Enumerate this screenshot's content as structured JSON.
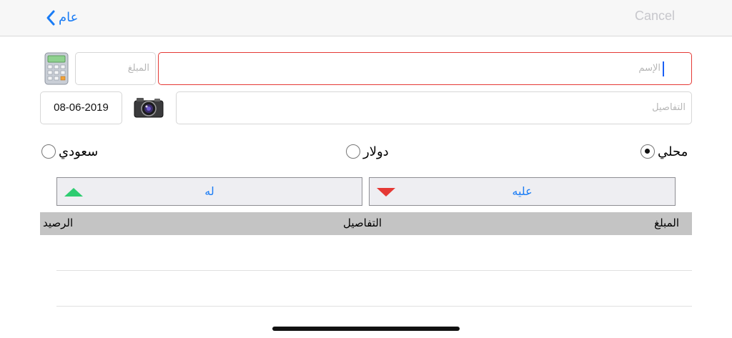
{
  "navbar": {
    "back_label": "عام",
    "cancel_label": "Cancel"
  },
  "form": {
    "name_placeholder": "الإسم",
    "amount_placeholder": "المبلغ",
    "date_value": "08-06-2019",
    "details_placeholder": "التفاصيل"
  },
  "currency": {
    "options": [
      {
        "label": "محلي",
        "selected": true
      },
      {
        "label": "دولار",
        "selected": false
      },
      {
        "label": "سعودي",
        "selected": false
      }
    ]
  },
  "buttons": {
    "debit_label": "عليه",
    "credit_label": "له"
  },
  "table": {
    "headers": [
      "المبلغ",
      "التفاصيل",
      "الرصيد"
    ],
    "rows": []
  },
  "colors": {
    "accent": "#1a7cf5",
    "error_border": "#e53935",
    "up_arrow": "#2ecc71",
    "down_arrow": "#e53935",
    "header_bg": "#c4c4c4"
  },
  "icons": [
    "chevron-left-icon",
    "calculator-icon",
    "camera-icon",
    "triangle-up-icon",
    "triangle-down-icon"
  ]
}
